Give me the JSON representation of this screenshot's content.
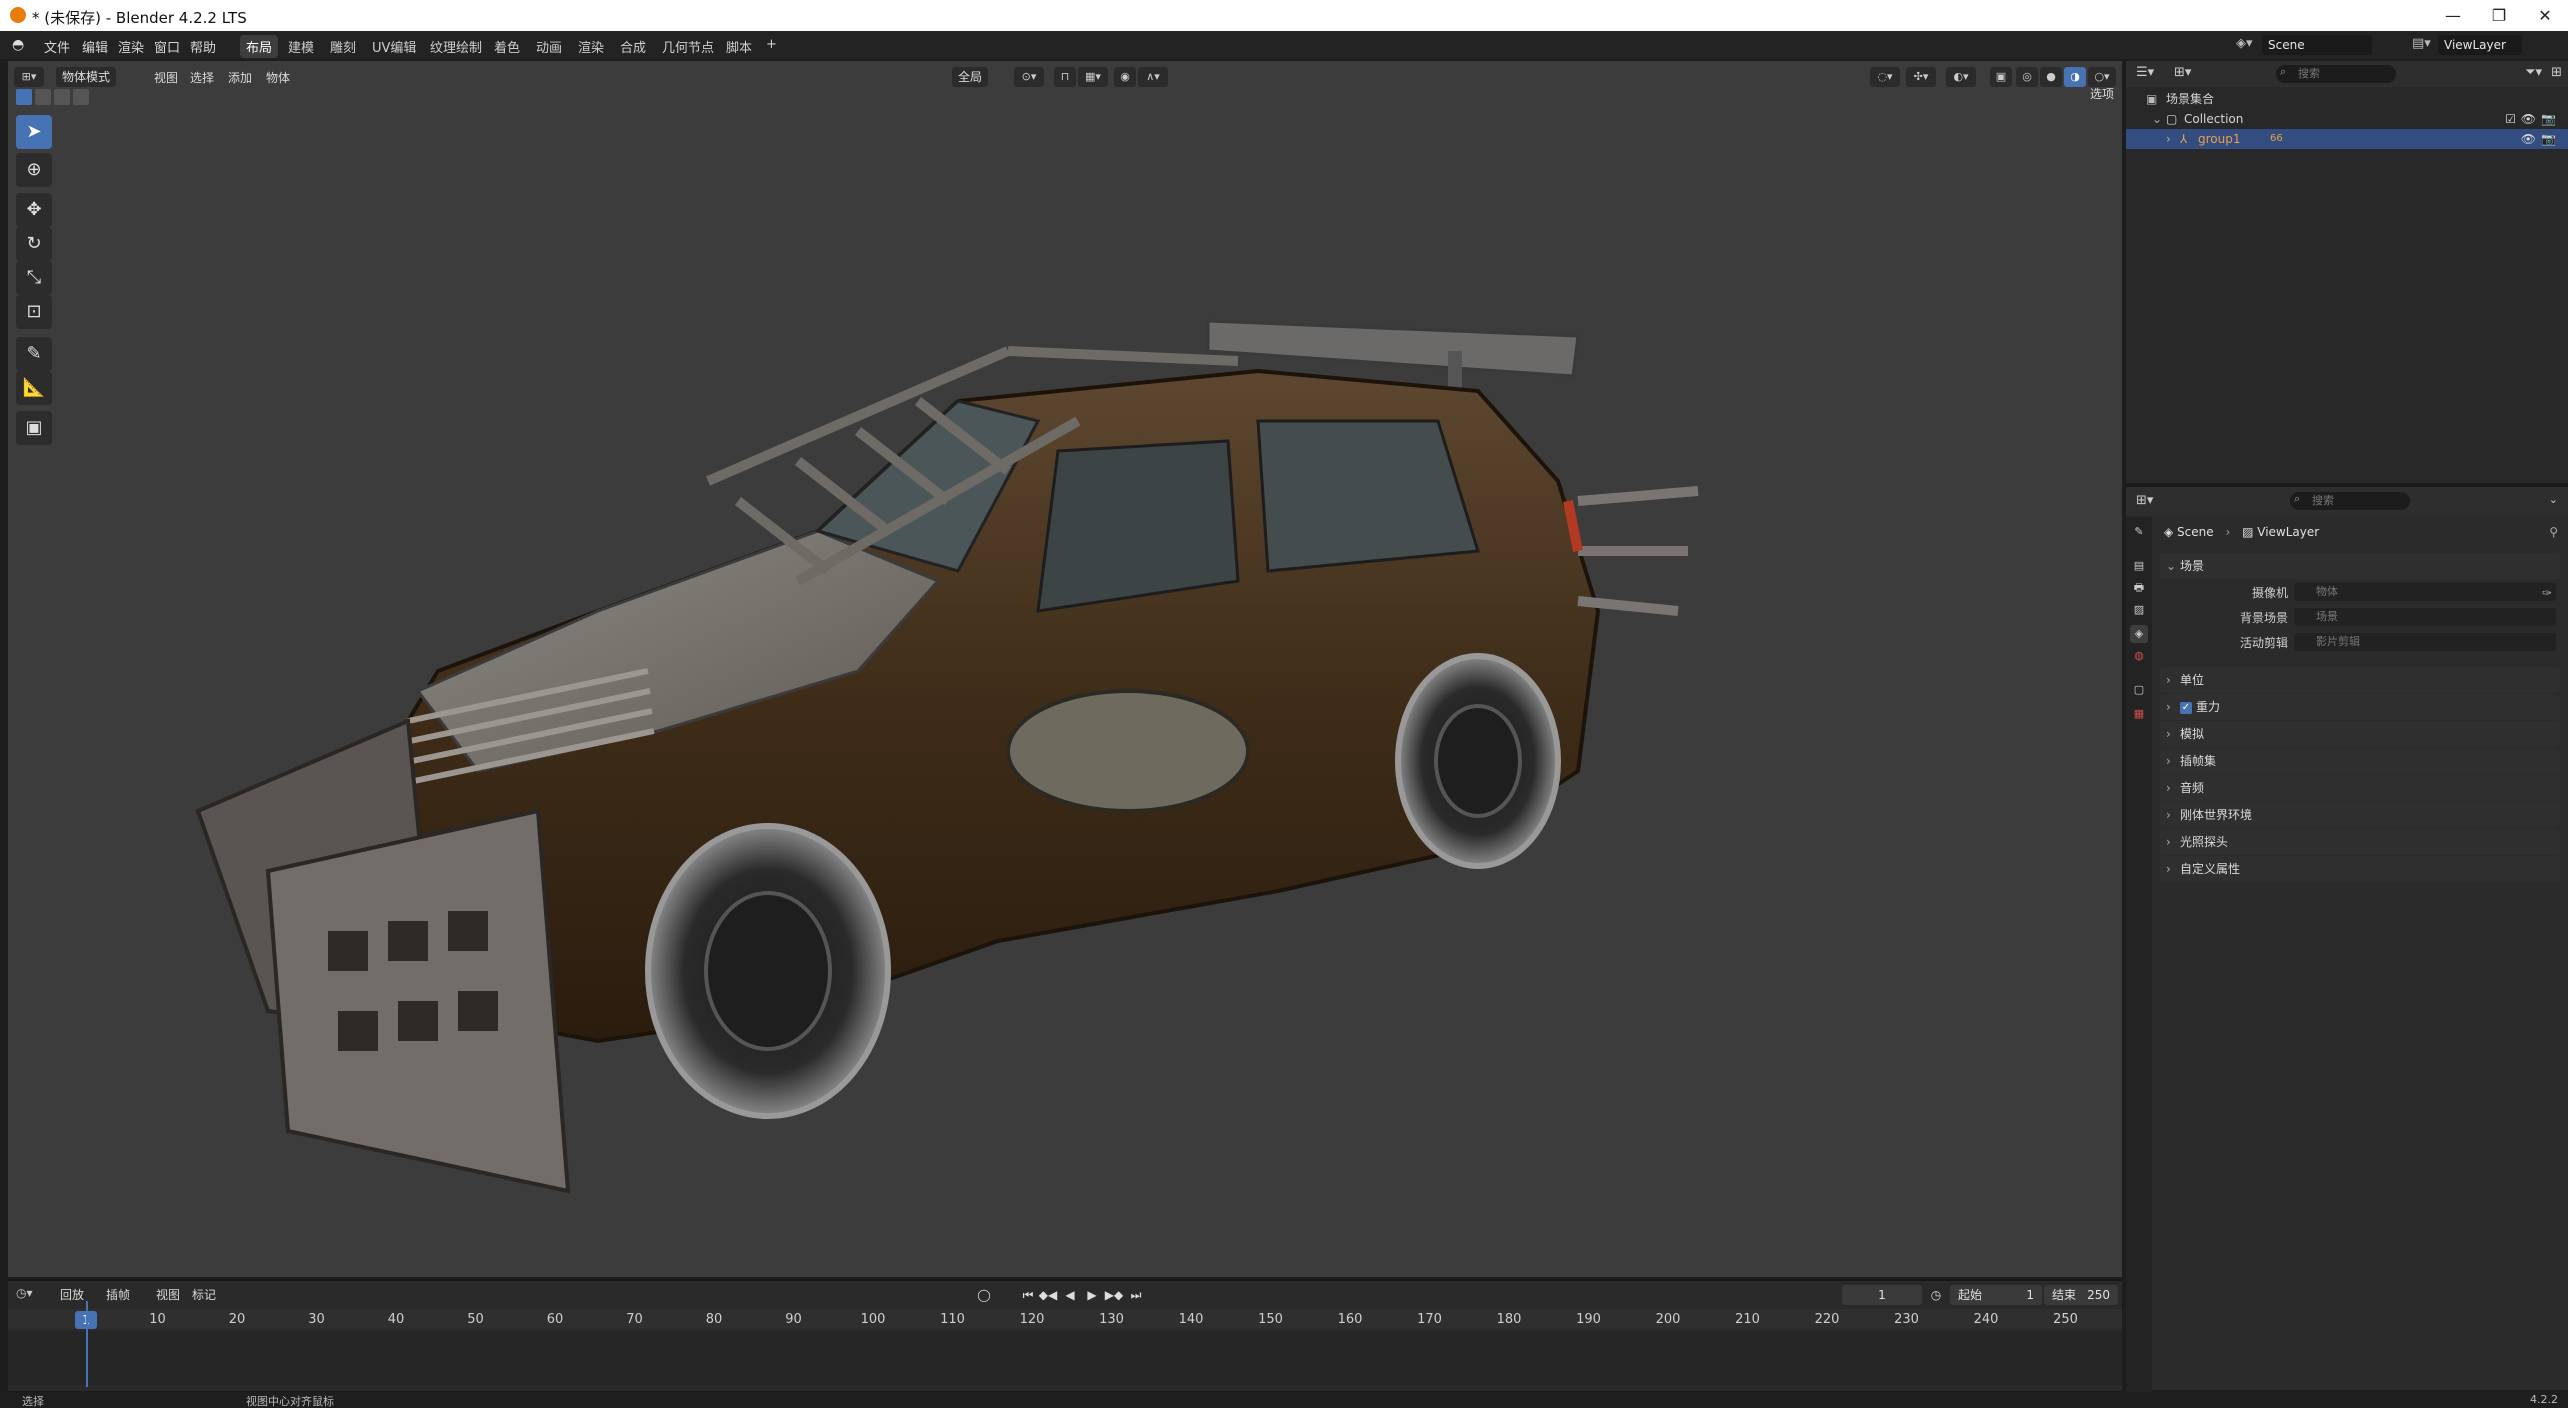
{
  "window": {
    "title": "* (未保存) - Blender 4.2.2 LTS",
    "minimize": "—",
    "maximize": "❐",
    "close": "✕"
  },
  "menu": {
    "items": [
      "文件",
      "编辑",
      "渲染",
      "窗口",
      "帮助"
    ]
  },
  "workspaces": {
    "tabs": [
      "布局",
      "建模",
      "雕刻",
      "UV编辑",
      "纹理绘制",
      "着色",
      "动画",
      "渲染",
      "合成",
      "几何节点",
      "脚本"
    ],
    "active": "布局",
    "add": "+"
  },
  "scene_selector": {
    "scene": "Scene",
    "view_layer": "ViewLayer"
  },
  "viewport": {
    "mode": "物体模式",
    "menus": [
      "视图",
      "选择",
      "添加",
      "物体"
    ],
    "transform_orientation": "全局",
    "options": "选项"
  },
  "outliner": {
    "search_placeholder": "搜索",
    "root": "场景集合",
    "collection": "Collection",
    "object": "group1",
    "object_badge": "66"
  },
  "properties": {
    "search_placeholder": "搜索",
    "breadcrumb_scene": "Scene",
    "breadcrumb_layer": "ViewLayer",
    "scene_panel": "场景",
    "camera_label": "摄像机",
    "camera_placeholder": "物体",
    "bg_scene_label": "背景场景",
    "bg_scene_placeholder": "场景",
    "active_clip_label": "活动剪辑",
    "active_clip_placeholder": "影片剪辑",
    "panels": [
      "单位",
      "重力",
      "模拟",
      "插帧集",
      "音频",
      "刚体世界环境",
      "光照探头",
      "自定义属性"
    ]
  },
  "timeline": {
    "menus": [
      "回放",
      "插帧",
      "视图",
      "标记"
    ],
    "current_frame": "1",
    "start_label": "起始",
    "start_value": "1",
    "end_label": "结束",
    "end_value": "250",
    "ticks": [
      "10",
      "20",
      "30",
      "40",
      "50",
      "60",
      "70",
      "80",
      "90",
      "100",
      "110",
      "120",
      "130",
      "140",
      "150",
      "160",
      "170",
      "180",
      "190",
      "200",
      "210",
      "220",
      "230",
      "240",
      "250"
    ]
  },
  "status": {
    "left": "选择",
    "middle": "视图中心对齐鼠标",
    "version": "4.2.2"
  },
  "colors": {
    "accent": "#4772b3",
    "selected_object": "#e8a04d",
    "viewport_bg": "#3c3c3c"
  }
}
